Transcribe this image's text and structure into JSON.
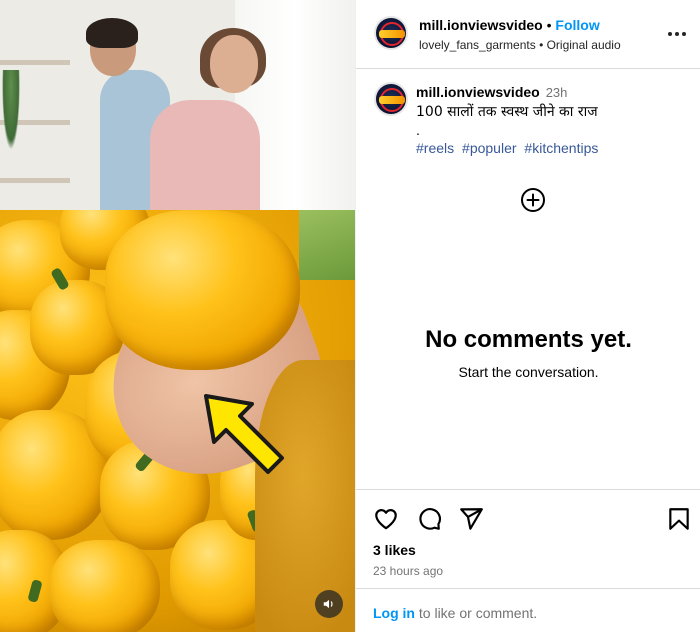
{
  "header": {
    "username": "mill.ionviewsvideo",
    "separator": "•",
    "follow_label": "Follow",
    "audio": "lovely_fans_garments • Original audio",
    "more_icon": "more-horizontal-icon"
  },
  "caption": {
    "username": "mill.ionviewsvideo",
    "time": "23h",
    "text": "100 सालों तक स्वस्थ जीने का राज",
    "dot": ".",
    "hashtags": [
      "#reels",
      "#populer",
      "#kitchentips"
    ]
  },
  "comments": {
    "add_icon": "plus-circle-icon",
    "empty_title": "No comments yet.",
    "empty_subtitle": "Start the conversation."
  },
  "actions": {
    "like_icon": "heart-icon",
    "comment_icon": "comment-icon",
    "share_icon": "send-icon",
    "save_icon": "bookmark-icon",
    "likes": "3 likes",
    "time_ago": "23 hours ago"
  },
  "footer": {
    "login_link": "Log in",
    "login_rest": " to like or comment."
  },
  "media": {
    "mute_icon": "volume-icon",
    "arrow_color": "#ffe600"
  },
  "colors": {
    "link_blue": "#0095f6",
    "hashtag_blue": "#385898",
    "muted": "#737373"
  }
}
